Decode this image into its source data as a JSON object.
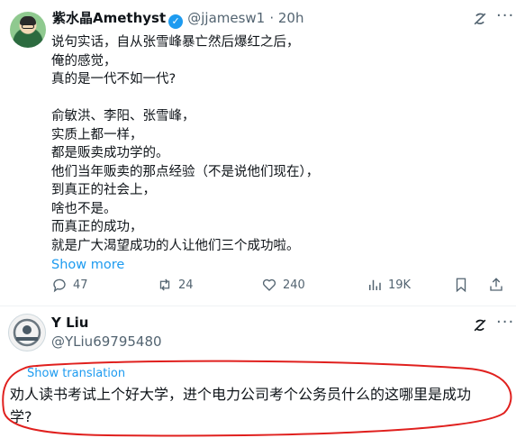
{
  "tweet": {
    "author_name": "紫水晶Amethyst",
    "handle": "@jjamesw1",
    "time": "· 20h",
    "verified_glyph": "✓",
    "more_glyph": "···",
    "lines": [
      "说句实话，自从张雪峰暴亡然后爆红之后，",
      "俺的感觉，",
      "真的是一代不如一代?",
      "",
      "俞敏洪、李阳、张雪峰，",
      "实质上都一样，",
      "都是贩卖成功学的。",
      "他们当年贩卖的那点经验（不是说他们现在），",
      "到真正的社会上，",
      "啥也不是。",
      "而真正的成功，",
      "就是广大渴望成功的人让他们三个成功啦。"
    ],
    "show_more": "Show more",
    "actions": {
      "replies": "47",
      "retweets": "24",
      "likes": "240",
      "views": "19K"
    }
  },
  "reply": {
    "author_name": "Y Liu",
    "handle": "@YLiu69795480",
    "translate_label": "Show translation",
    "text_line1": "劝人读书考试上个好大学，进个电力公司考个公务员什么的这哪里是成功",
    "text_line2": "学?",
    "more_glyph": "···"
  },
  "icons": [
    "grok-icon",
    "more-icon",
    "reply-icon",
    "retweet-icon",
    "like-icon",
    "views-icon",
    "bookmark-icon",
    "share-icon",
    "verified-icon"
  ],
  "colors": {
    "accent": "#1d9bf0",
    "muted": "#536471",
    "annotation": "#e0201e"
  }
}
